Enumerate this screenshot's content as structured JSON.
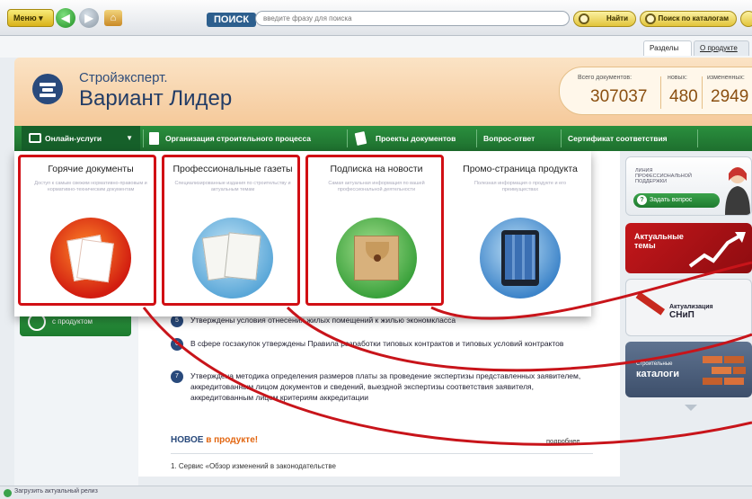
{
  "toolbar": {
    "menu_label": "Меню",
    "search_label": "ПОИСК",
    "search_placeholder": "введите фразу для поиска",
    "find_label": "Найти",
    "catalog_search_label": "Поиск по каталогам"
  },
  "subtabs": {
    "sections": "Разделы",
    "about": "О продукте"
  },
  "brand": {
    "small": "Стройэксперт.",
    "big": "Вариант Лидер"
  },
  "stats": {
    "total_label": "Всего документов:",
    "total_value": "307037",
    "new_label": "новых:",
    "new_value": "480",
    "changed_label": "измененных:",
    "changed_value": "2949"
  },
  "nav": {
    "online": "Онлайн-услуги",
    "org": "Организация строительного процесса",
    "projects": "Проекты документов",
    "qa": "Вопрос-ответ",
    "cert": "Сертификат соответствия"
  },
  "dropdown": [
    {
      "title": "Горячие документы",
      "desc": "Доступ к самым свежим нормативно-правовым и нормативно-техническим документам"
    },
    {
      "title": "Профессиональные газеты",
      "desc": "Специализированные издания по строительству и актуальным темам"
    },
    {
      "title": "Подписка на новости",
      "desc": "Самая актуальная информация по вашей профессиональной деятельности"
    },
    {
      "title": "Промо-страница продукта",
      "desc": "Полезная информация о продукте и его преимуществах"
    }
  ],
  "left": {
    "product_button": "с продуктом"
  },
  "news": [
    {
      "num": "5",
      "text": "Утверждены условия отнесения жилых помещений к жилью экономкласса"
    },
    {
      "num": "6",
      "text": "В сфере госзакупок утверждены Правила разработки типовых контрактов и типовых условий контрактов"
    },
    {
      "num": "7",
      "text": "Утверждена методика определения размеров платы за проведение экспертизы представленных заявителем, аккредитованным лицом документов и сведений, выездной экспертизы соответствия заявителя, аккредитованным лицом критериям аккредитации"
    }
  ],
  "new_section": {
    "title_prefix": "НОВОЕ",
    "title_accent": "в продукте!",
    "more": "подробнее",
    "item": "1.   Сервис «Обзор изменений в законодательстве"
  },
  "right": {
    "consult_text": "ЛИНИЯ ПРОФЕССИОНАЛЬНОЙ ПОДДЕРЖКИ",
    "ask_button": "Задать вопрос",
    "topics": "Актуальные темы",
    "snip_line1": "Актуализация",
    "snip_line2": "СНиП",
    "catalogs_small": "Строительные",
    "catalogs": "каталоги"
  },
  "status": {
    "text": "Загрузить актуальный релиз"
  }
}
